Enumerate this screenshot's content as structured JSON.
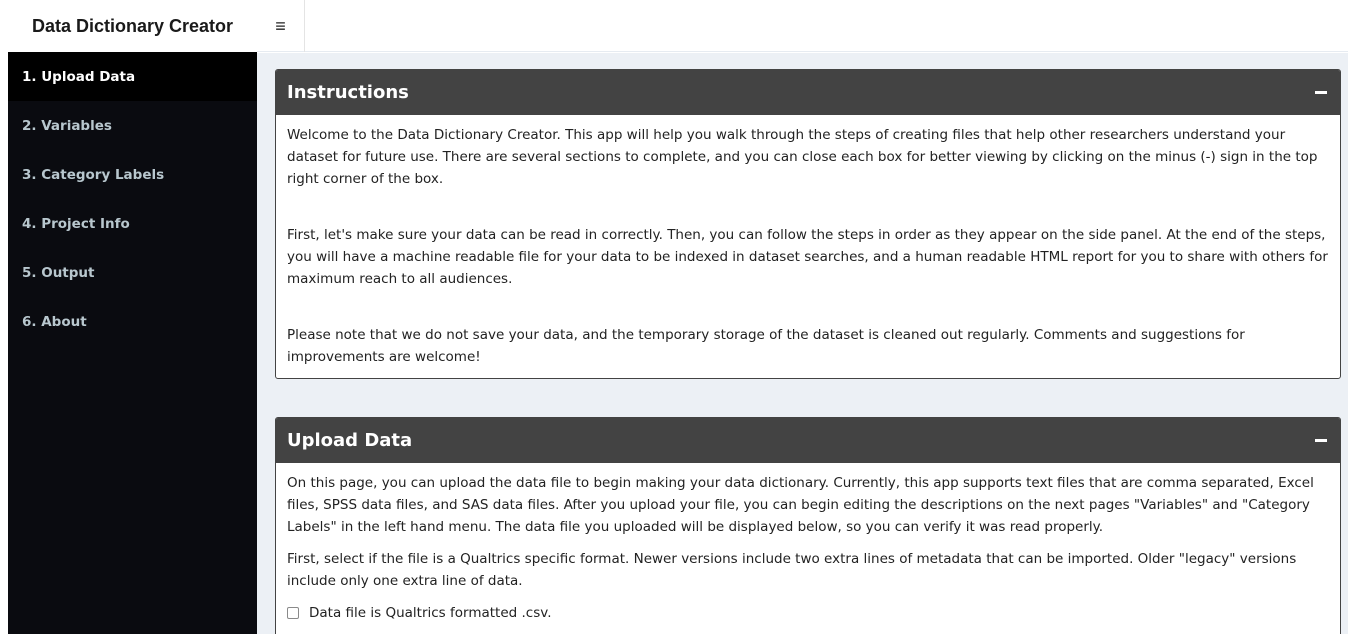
{
  "app": {
    "title": "Data Dictionary Creator",
    "menu_toggle": "≡"
  },
  "sidebar": {
    "items": [
      {
        "label": "1. Upload Data",
        "active": true
      },
      {
        "label": "2. Variables",
        "active": false
      },
      {
        "label": "3. Category Labels",
        "active": false
      },
      {
        "label": "4. Project Info",
        "active": false
      },
      {
        "label": "5. Output",
        "active": false
      },
      {
        "label": "6. About",
        "active": false
      }
    ]
  },
  "instructions": {
    "title": "Instructions",
    "paragraphs": [
      "Welcome to the Data Dictionary Creator. This app will help you walk through the steps of creating files that help other researchers understand your dataset for future use. There are several sections to complete, and you can close each box for better viewing by clicking on the minus (-) sign in the top right corner of the box.",
      "First, let's make sure your data can be read in correctly. Then, you can follow the steps in order as they appear on the side panel. At the end of the steps, you will have a machine readable file for your data to be indexed in dataset searches, and a human readable HTML report for you to share with others for maximum reach to all audiences.",
      "Please note that we do not save your data, and the temporary storage of the dataset is cleaned out regularly. Comments and suggestions for improvements are welcome!"
    ]
  },
  "upload": {
    "title": "Upload Data",
    "paragraphs": [
      "On this page, you can upload the data file to begin making your data dictionary. Currently, this app supports text files that are comma separated, Excel files, SPSS data files, and SAS data files. After you upload your file, you can begin editing the descriptions on the next pages \"Variables\" and \"Category Labels\" in the left hand menu. The data file you uploaded will be displayed below, so you can verify it was read properly.",
      "First, select if the file is a Qualtrics specific format. Newer versions include two extra lines of metadata that can be imported. Older \"legacy\" versions include only one extra line of data."
    ],
    "qualtrics_checkbox_label": "Data file is Qualtrics formatted .csv.",
    "qualtrics_checked": false
  },
  "colors": {
    "sidebar_bg": "#0a0b10",
    "sidebar_active_bg": "#000000",
    "sidebar_text": "#b8c7ce",
    "box_header_bg": "#434343",
    "content_bg": "#ecf0f5"
  },
  "icons": {
    "menu_toggle": "hamburger-icon",
    "collapse": "minus-icon"
  }
}
